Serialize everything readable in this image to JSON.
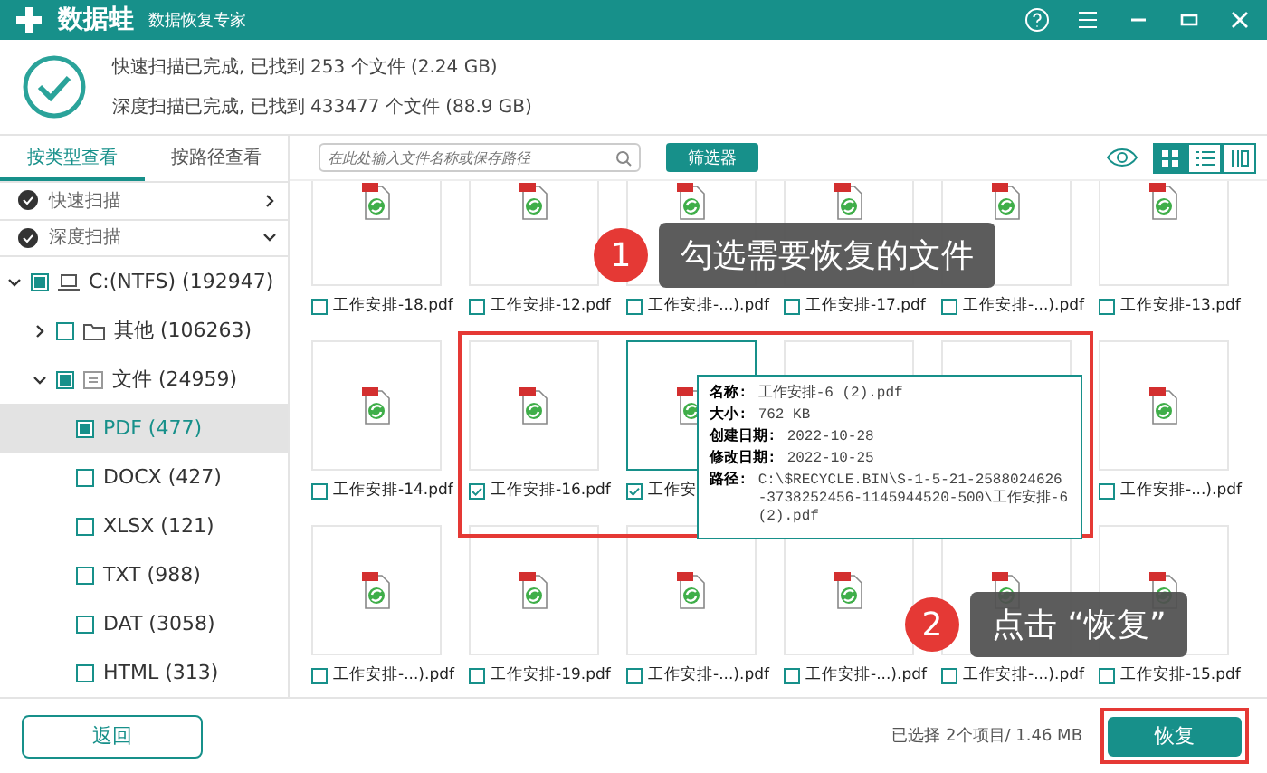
{
  "title_bar": {
    "logo": "数据蛙",
    "subtitle": "数据恢复专家"
  },
  "scan_summary": [
    "快速扫描已完成, 已找到 253 个文件 (2.24 GB)",
    "深度扫描已完成, 已找到 433477 个文件 (88.9 GB)"
  ],
  "sidebar": {
    "tabs": [
      {
        "label": "按类型查看",
        "selected": true
      },
      {
        "label": "按路径查看",
        "selected": false
      }
    ],
    "scans": [
      {
        "label": "快速扫描",
        "expanded": false
      },
      {
        "label": "深度扫描",
        "expanded": true
      }
    ],
    "tree": [
      {
        "label": "C:(NTFS) (192947)",
        "kind": "drive",
        "checked": true,
        "expanded": true,
        "selected": false,
        "children": [
          {
            "label": "其他 (106263)",
            "kind": "folder",
            "checked": false,
            "expanded": false,
            "selected": false
          },
          {
            "label": "文件 (24959)",
            "kind": "doc",
            "checked": true,
            "expanded": true,
            "selected": false,
            "children": [
              {
                "label": "PDF (477)",
                "checked": true,
                "selected": true
              },
              {
                "label": "DOCX (427)",
                "checked": false,
                "selected": false
              },
              {
                "label": "XLSX (121)",
                "checked": false,
                "selected": false
              },
              {
                "label": "TXT (988)",
                "checked": false,
                "selected": false
              },
              {
                "label": "DAT (3058)",
                "checked": false,
                "selected": false
              },
              {
                "label": "HTML (313)",
                "checked": false,
                "selected": false
              }
            ]
          }
        ]
      }
    ]
  },
  "toolbar": {
    "search": {
      "placeholder": "在此处输入文件名称或保存路径"
    },
    "filter_button": "筛选器"
  },
  "files": [
    [
      {
        "name": "工作安排-18.pdf",
        "checked": false,
        "selected": false
      },
      {
        "name": "工作安排-12.pdf",
        "checked": false,
        "selected": false
      },
      {
        "name": "工作安排-...).pdf",
        "checked": false,
        "selected": false
      },
      {
        "name": "工作安排-17.pdf",
        "checked": false,
        "selected": false
      },
      {
        "name": "工作安排-...).pdf",
        "checked": false,
        "selected": false
      },
      {
        "name": "工作安排-13.pdf",
        "checked": false,
        "selected": false
      }
    ],
    [
      {
        "name": "工作安排-14.pdf",
        "checked": false,
        "selected": false
      },
      {
        "name": "工作安排-16.pdf",
        "checked": true,
        "selected": false
      },
      {
        "name": "工作安",
        "checked": true,
        "selected": true
      },
      {
        "selected": false
      },
      {
        "selected": false
      },
      {
        "name": "工作安排-...).pdf",
        "checked": false,
        "selected": false
      }
    ],
    [
      {
        "name": "工作安排-...).pdf",
        "checked": false,
        "selected": false
      },
      {
        "name": "工作安排-19.pdf",
        "checked": false,
        "selected": false
      },
      {
        "name": "工作安排-...).pdf",
        "checked": false,
        "selected": false
      },
      {
        "name": "工作安排-...).pdf",
        "checked": false,
        "selected": false
      },
      {
        "name": "工作安排-...).pdf",
        "checked": false,
        "selected": false
      },
      {
        "name": "工作安排-15.pdf",
        "checked": false,
        "selected": false
      }
    ]
  ],
  "tooltip": [
    {
      "label": "名称:",
      "value": "工作安排-6 (2).pdf"
    },
    {
      "label": "大小:",
      "value": "762 KB"
    },
    {
      "label": "创建日期:",
      "value": "2022-10-28"
    },
    {
      "label": "修改日期:",
      "value": "2022-10-25"
    },
    {
      "label": "路径:",
      "value": "C:\\$RECYCLE.BIN\\S-1-5-21-2588024626-3738252456-1145944520-500\\工作安排-6 (2).pdf"
    }
  ],
  "callouts": [
    {
      "number": "1",
      "text": "勾选需要恢复的文件"
    },
    {
      "number": "2",
      "text": "点击 “恢复”"
    }
  ],
  "footer": {
    "back_button": "返回",
    "selection": "已选择 2个项目/ 1.46 MB",
    "recover_button": "恢复"
  }
}
